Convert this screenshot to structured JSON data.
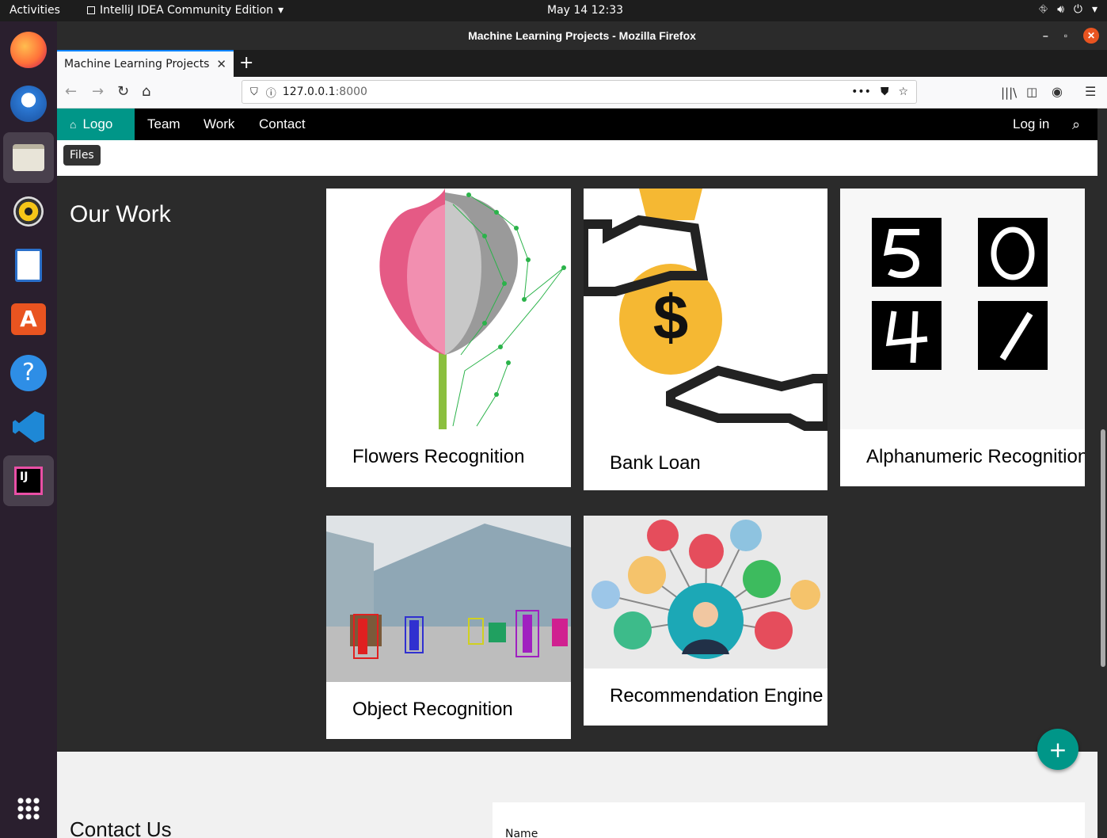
{
  "topbar": {
    "activities": "Activities",
    "app_name": "IntelliJ IDEA Community Edition",
    "clock": "May 14  12:33"
  },
  "window": {
    "title": "Machine Learning Projects - Mozilla Firefox"
  },
  "tab": {
    "label": "Machine Learning Projects"
  },
  "url": {
    "host": "127.0.0.1",
    "port": ":8000"
  },
  "site_nav": {
    "logo": "Logo",
    "items": [
      "Team",
      "Work",
      "Contact"
    ],
    "login": "Log in"
  },
  "tooltip": "Files",
  "section_title": "Our Work",
  "cards": [
    {
      "title": "Flowers Recognition"
    },
    {
      "title": "Bank Loan"
    },
    {
      "title": "Alphanumeric Recognition"
    },
    {
      "title": "Object Recognition"
    },
    {
      "title": "Recommendation Engine"
    }
  ],
  "contact": {
    "title": "Contact Us",
    "name_label": "Name"
  },
  "fab": "+",
  "colors": {
    "accent": "#009688",
    "nav_bg": "#000000",
    "section_bg": "#2b2b2b",
    "ubuntu_orange": "#e95420"
  }
}
